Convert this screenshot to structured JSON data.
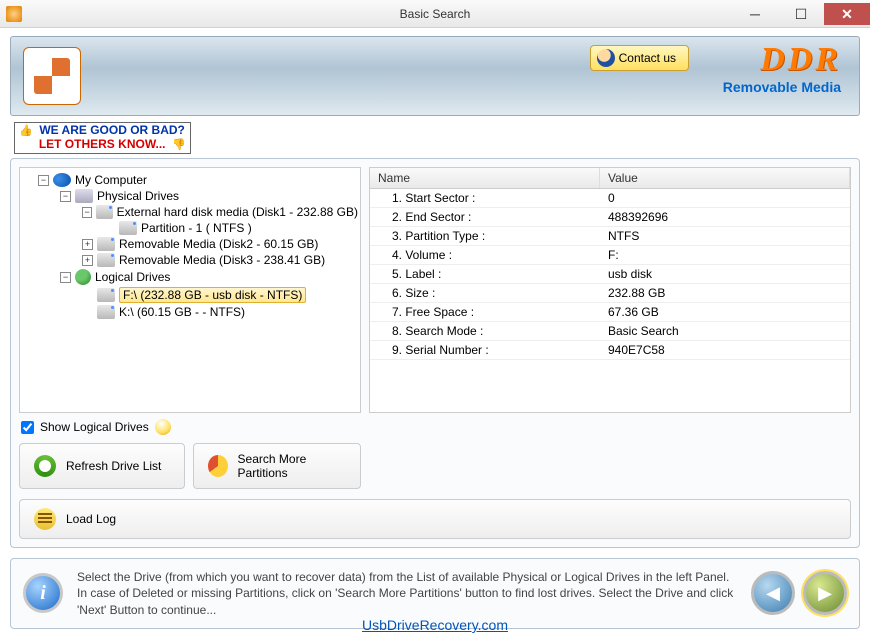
{
  "window": {
    "title": "Basic Search"
  },
  "banner": {
    "contact_label": "Contact us",
    "brand": "DDR",
    "brand_sub": "Removable Media"
  },
  "feedback": {
    "line1": "WE ARE GOOD OR BAD?",
    "line2": "LET OTHERS KNOW..."
  },
  "tree": {
    "root": "My Computer",
    "physical": "Physical Drives",
    "disk1": "External hard disk media (Disk1 - 232.88 GB)",
    "disk1_part": "Partition - 1 ( NTFS )",
    "disk2": "Removable Media (Disk2 - 60.15 GB)",
    "disk3": "Removable Media (Disk3 - 238.41 GB)",
    "logical": "Logical Drives",
    "driveF": "F:\\ (232.88 GB - usb disk - NTFS)",
    "driveK": "K:\\ (60.15 GB -  - NTFS)"
  },
  "grid": {
    "header_name": "Name",
    "header_value": "Value",
    "rows": [
      {
        "name": "1. Start Sector :",
        "value": "0"
      },
      {
        "name": "2. End Sector :",
        "value": "488392696"
      },
      {
        "name": "3. Partition Type :",
        "value": "NTFS"
      },
      {
        "name": "4. Volume :",
        "value": "F:"
      },
      {
        "name": "5. Label :",
        "value": "usb disk"
      },
      {
        "name": "6. Size :",
        "value": "232.88 GB"
      },
      {
        "name": "7. Free Space :",
        "value": "67.36 GB"
      },
      {
        "name": "8. Search Mode :",
        "value": "Basic Search"
      },
      {
        "name": "9. Serial Number :",
        "value": "940E7C58"
      }
    ]
  },
  "controls": {
    "show_logical": "Show Logical Drives",
    "refresh": "Refresh Drive List",
    "search_more": "Search More Partitions",
    "load_log": "Load Log"
  },
  "info": "Select the Drive (from which you want to recover data) from the List of available Physical or Logical Drives in the left Panel. In case of Deleted or missing Partitions, click on 'Search More Partitions' button to find lost drives. Select the Drive and click 'Next' Button to continue...",
  "footer": "UsbDriveRecovery.com"
}
